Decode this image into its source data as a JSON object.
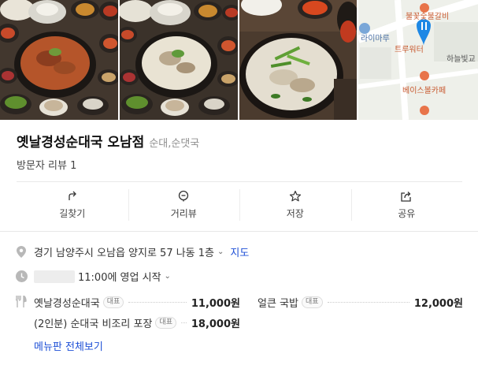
{
  "place": {
    "name": "옛날경성순대국 오남점",
    "category": "순대,순댓국",
    "reviews": "방문자 리뷰 1"
  },
  "map": {
    "labels": [
      "불꽃숯불갈비",
      "라이마루",
      "트루워터",
      "하늘빛교",
      "베이스볼카페"
    ]
  },
  "actions": [
    {
      "label": "길찾기",
      "icon": "directions-icon"
    },
    {
      "label": "거리뷰",
      "icon": "street-view-icon"
    },
    {
      "label": "저장",
      "icon": "star-icon"
    },
    {
      "label": "공유",
      "icon": "share-icon"
    }
  ],
  "info": {
    "address": "경기 남양주시 오남읍 양지로 57 나동 1층",
    "map_link": "지도",
    "hours": "11:00에 영업 시작"
  },
  "menu": {
    "items": [
      {
        "name": "옛날경성순대국",
        "badge": "대표",
        "price": "11,000원"
      },
      {
        "name": "얼큰 국밥",
        "badge": "대표",
        "price": "12,000원"
      },
      {
        "name": "(2인분) 순대국 비조리 포장",
        "badge": "대표",
        "price": "18,000원"
      }
    ],
    "view_all": "메뉴판 전체보기"
  },
  "colors": {
    "link": "#1d4fd6",
    "map_pin": "#1e88e5"
  }
}
